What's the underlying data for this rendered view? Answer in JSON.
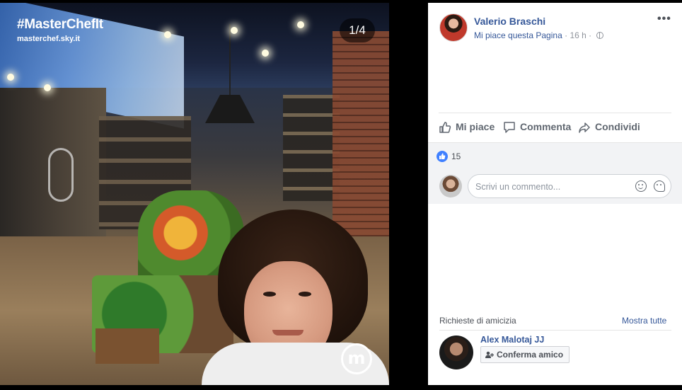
{
  "photo": {
    "brand": "#MasterChefIt",
    "site": "masterchef.sky.it",
    "counter": "1/4",
    "watermark_icon": "masterchef-logo-icon"
  },
  "post": {
    "author": "Valerio Braschi",
    "page_action": "Mi piace questa Pagina",
    "separator": "·",
    "time": "16 h",
    "privacy_icon": "globe-icon",
    "menu_label": "•••"
  },
  "actions": {
    "like": "Mi piace",
    "comment": "Commenta",
    "share": "Condividi"
  },
  "reactions": {
    "like_count": "15"
  },
  "comment": {
    "placeholder": "Scrivi un commento..."
  },
  "friends": {
    "title": "Richieste di amicizia",
    "show_all": "Mostra tutte",
    "requests": [
      {
        "name": "Alex Malotaj JJ",
        "confirm": "Conferma amico"
      }
    ]
  },
  "colors": {
    "link": "#365899",
    "like_blue": "#4080ff",
    "muted": "#90949c"
  }
}
